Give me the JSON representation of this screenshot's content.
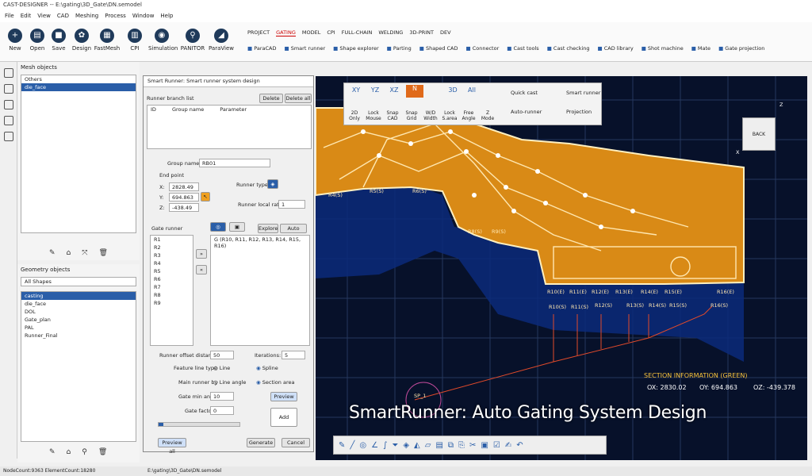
{
  "app": {
    "title": "CAST-DESIGNER -- E:\\gating\\3D_Gate\\DN.semodel"
  },
  "menu": [
    "File",
    "Edit",
    "View",
    "CAD",
    "Meshing",
    "Process",
    "Window",
    "Help"
  ],
  "ribbon": {
    "big": [
      "New",
      "Open",
      "Save",
      "Design",
      "FastMesh",
      "CPI",
      "Simulation",
      "PANITOR",
      "ParaView"
    ],
    "tabs": [
      "PROJECT",
      "GATING",
      "MODEL",
      "CPI",
      "FULL-CHAIN",
      "WELDING",
      "3D-PRINT",
      "DEV"
    ],
    "tools": [
      "ParaCAD",
      "Smart runner",
      "Shape explorer",
      "Parting",
      "Shaped CAD",
      "Connector",
      "Cast tools",
      "Cast checking",
      "CAD library",
      "Shot machine",
      "Mate",
      "Gate projection"
    ]
  },
  "mesh": {
    "title": "Mesh objects",
    "items": [
      "Others",
      "die_face"
    ]
  },
  "geom": {
    "title": "Geometry objects",
    "filter": "All Shapes",
    "items": [
      "casting",
      "die_face",
      "DOL",
      "Gate_plan",
      "PAL",
      "Runner_Final"
    ]
  },
  "dialog": {
    "title": "Smart Runner: Smart runner system design",
    "branch_list": "Runner branch list",
    "delete": "Delete",
    "delete_all": "Delete all",
    "cols": [
      "ID",
      "Group name",
      "Parameter"
    ],
    "group_name_label": "Group name:",
    "group_name": "RB01",
    "end_point": "End point",
    "x": "2828.49",
    "y": "694.863",
    "z": "-438.49",
    "runner_type": "Runner type:",
    "ratio_label": "Runner local ratio:",
    "ratio": "1",
    "explore": "Explore",
    "auto_group": "Auto group",
    "gate_runner": "Gate runner",
    "gates": [
      "R1",
      "R2",
      "R3",
      "R4",
      "R5",
      "R6",
      "R7",
      "R8",
      "R9"
    ],
    "group": "G (R10, R11, R12, R13, R14, R15, R16)",
    "offset_label": "Runner offset distance:",
    "offset": "50",
    "iter_label": "Iterations:",
    "iter": "5",
    "feature_label": "Feature line type",
    "line": "Line",
    "spline": "Spline",
    "main_by": "Main runner by",
    "line_angle": "Line angle",
    "section_area": "Section area",
    "min_angle_label": "Gate min angle:",
    "min_angle": "10",
    "factor_label": "Gate factor:",
    "factor": "0",
    "preview": "Preview",
    "add": "Add",
    "preview_all": "Preview all",
    "generate": "Generate",
    "cancel": "Cancel"
  },
  "viewtools": {
    "icons": [
      "XY",
      "YZ",
      "XZ",
      "N",
      "",
      "3D",
      "All",
      ""
    ],
    "labels": [
      "2D Only",
      "Lock Mouse",
      "Snap CAD",
      "Snap Grid",
      "W/D Width",
      "Lock S.area",
      "Free Angle",
      "Z Mode"
    ],
    "right": [
      "Quick cast",
      "Smart runner",
      "Auto-runner",
      "Projection"
    ]
  },
  "viewport": {
    "gates_top": [
      "R4(S)",
      "R5(S)",
      "R6(S)",
      "R8(S)",
      "R9(S)"
    ],
    "gates_bottom": [
      "R10(S)",
      "R11(S)",
      "R12(S)",
      "R13(S)",
      "R14(S)",
      "R15(S)",
      "R16(S)"
    ],
    "gates_upper": [
      "R10(E)",
      "R11(E)",
      "R12(E)",
      "R13(E)",
      "R14(E)",
      "R15(E)",
      "R16(E)"
    ],
    "sprue": "SP_1",
    "back": "BACK",
    "axis_z": "Z",
    "axis_x": "X",
    "section_title": "SECTION INFORMATION (GREEN)",
    "ox": "OX: 2830.02",
    "oy": "OY: 694.863",
    "oz": "OZ: -439.378"
  },
  "caption": "SmartRunner: Auto Gating System Design",
  "status": {
    "counts": "NodeCount:9363  ElementCount:18280",
    "file": "E:\\gating\\3D_Gate\\DN.semodel"
  },
  "colors": {
    "casting": "#d98a16",
    "background": "#07112a",
    "accent": "#2a5ea8"
  }
}
